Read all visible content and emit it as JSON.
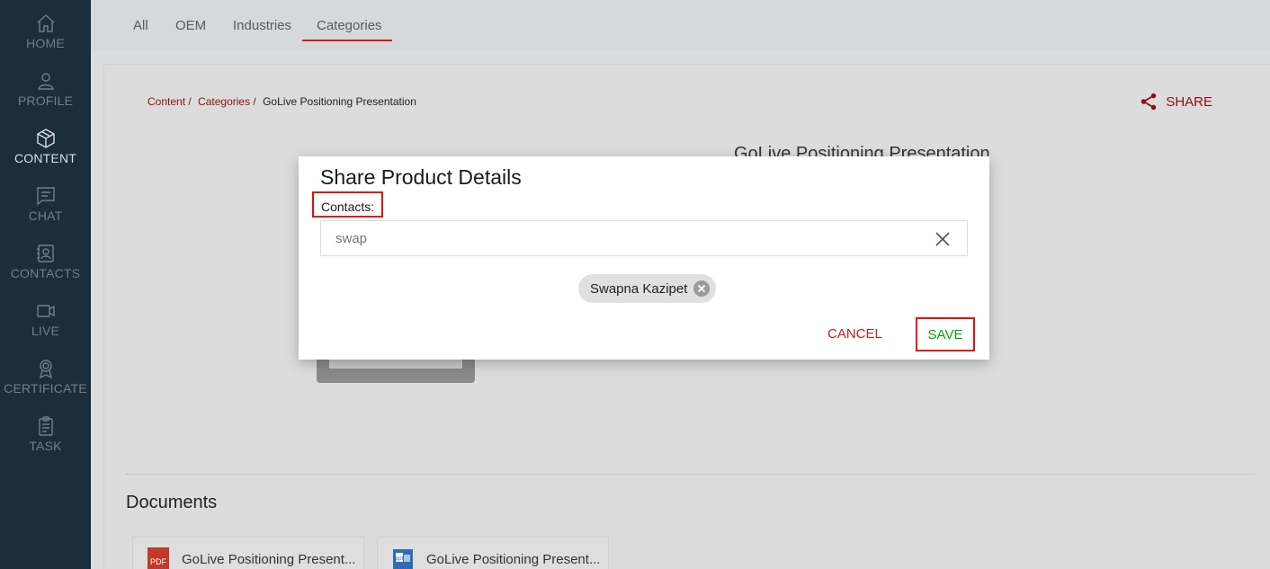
{
  "sidebar": {
    "items": [
      {
        "label": "HOME",
        "icon": "home-icon"
      },
      {
        "label": "PROFILE",
        "icon": "user-icon"
      },
      {
        "label": "CONTENT",
        "icon": "box-icon",
        "active": true
      },
      {
        "label": "CHAT",
        "icon": "chat-icon"
      },
      {
        "label": "CONTACTS",
        "icon": "contacts-icon"
      },
      {
        "label": "LIVE",
        "icon": "video-icon"
      },
      {
        "label": "CERTIFICATE",
        "icon": "award-icon"
      },
      {
        "label": "TASK",
        "icon": "clipboard-icon"
      }
    ]
  },
  "tabs": {
    "items": [
      "All",
      "OEM",
      "Industries",
      "Categories"
    ],
    "active": "Categories"
  },
  "breadcrumb": {
    "content": "Content /",
    "categories": "Categories /",
    "current": "GoLive Positioning Presentation"
  },
  "header": {
    "share_label": "SHARE"
  },
  "product": {
    "title": "GoLive Positioning Presentation"
  },
  "documents": {
    "title": "Documents",
    "items": [
      {
        "name": "GoLive Positioning Present...",
        "type": "PDF"
      },
      {
        "name": "GoLive Positioning Present...",
        "type": "ppt"
      }
    ]
  },
  "modal": {
    "title": "Share Product Details",
    "contacts_label": "Contacts:",
    "search_value": "swap",
    "selected_contact": "Swapna Kazipet",
    "cancel_label": "CANCEL",
    "save_label": "SAVE"
  },
  "colors": {
    "accent": "#c81e1e",
    "save": "#12a012",
    "sidebar_bg": "#1c2d3b"
  }
}
